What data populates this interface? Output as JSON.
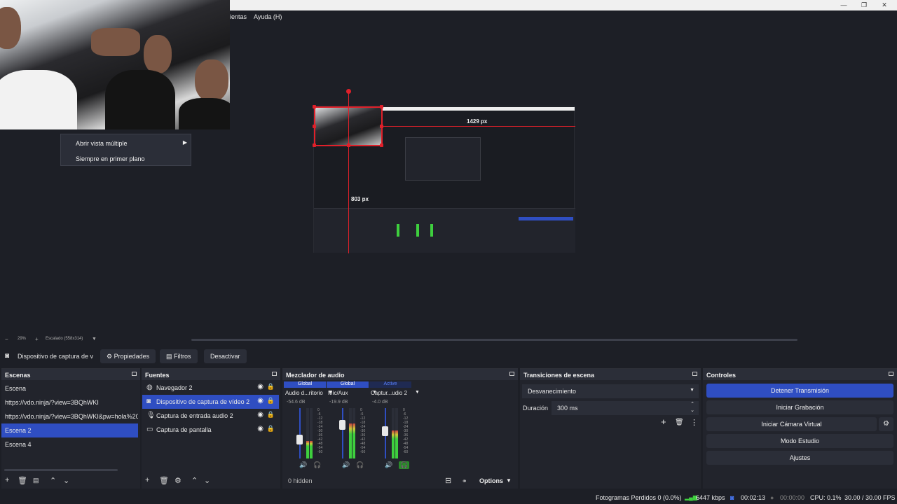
{
  "menu": {
    "herramientas": "ientas",
    "ayuda": "Ayuda (H)"
  },
  "context_menu": {
    "item1": "Abrir vista múltiple",
    "item2": "Siempre en primer plano"
  },
  "preview": {
    "width_label": "1429 px",
    "height_label": "803 px"
  },
  "zoom": {
    "minus": "−",
    "value": "29%",
    "plus": "+",
    "scale_label": "Escalado (558x314)"
  },
  "source_toolbar": {
    "source_name": "Dispositivo de captura de v",
    "properties": "Propiedades",
    "filters": "Filtros",
    "deactivate": "Desactivar"
  },
  "scenes": {
    "title": "Escenas",
    "items": [
      "Escena",
      "https://vdo.ninja/?view=3BQhWKI",
      "https://vdo.ninja/?view=3BQhWKI&pw=hola%20",
      "Escena 2",
      "Escena 4"
    ],
    "selected_index": 3
  },
  "sources": {
    "title": "Fuentes",
    "items": [
      "Navegador 2",
      "Dispositivo de captura de vídeo 2",
      "Captura de entrada audio 2",
      "Captura de pantalla"
    ],
    "selected_index": 1
  },
  "mixer": {
    "title": "Mezclador de audio",
    "channels": [
      {
        "tag": "Global",
        "name": "Audio d...ritorio",
        "db": "-54.6 dB",
        "level": 0.35
      },
      {
        "tag": "Global",
        "name": "Mic/Aux",
        "db": "-19.9 dB",
        "level": 0.7
      },
      {
        "tag": "Active",
        "name": "Captur...udio 2",
        "db": "-4.0 dB",
        "level": 0.55
      }
    ],
    "scale": [
      "0",
      "-6",
      "-12",
      "-18",
      "-24",
      "-30",
      "-36",
      "-42",
      "-48",
      "-54",
      "-60"
    ],
    "hidden_label": "0 hidden",
    "options": "Options"
  },
  "transitions": {
    "title": "Transiciones de escena",
    "selected": "Desvanecimiento",
    "duration_label": "Duración",
    "duration_value": "300 ms"
  },
  "controls": {
    "title": "Controles",
    "stop_stream": "Detener Transmisión",
    "start_recording": "Iniciar Grabación",
    "start_virtual_cam": "Iniciar Cámara Virtual",
    "studio_mode": "Modo Estudio",
    "settings": "Ajustes"
  },
  "status": {
    "dropped_frames": "Fotogramas Perdidos 0 (0.0%)",
    "bitrate": "6447 kbps",
    "stream_time": "00:02:13",
    "rec_time": "00:00:00",
    "cpu": "CPU: 0.1%",
    "fps": "30.00 / 30.00 FPS"
  },
  "colors": {
    "accent": "#2f4ec2",
    "red_guide": "#e0202a",
    "meter_green": "#3ecf3e"
  }
}
